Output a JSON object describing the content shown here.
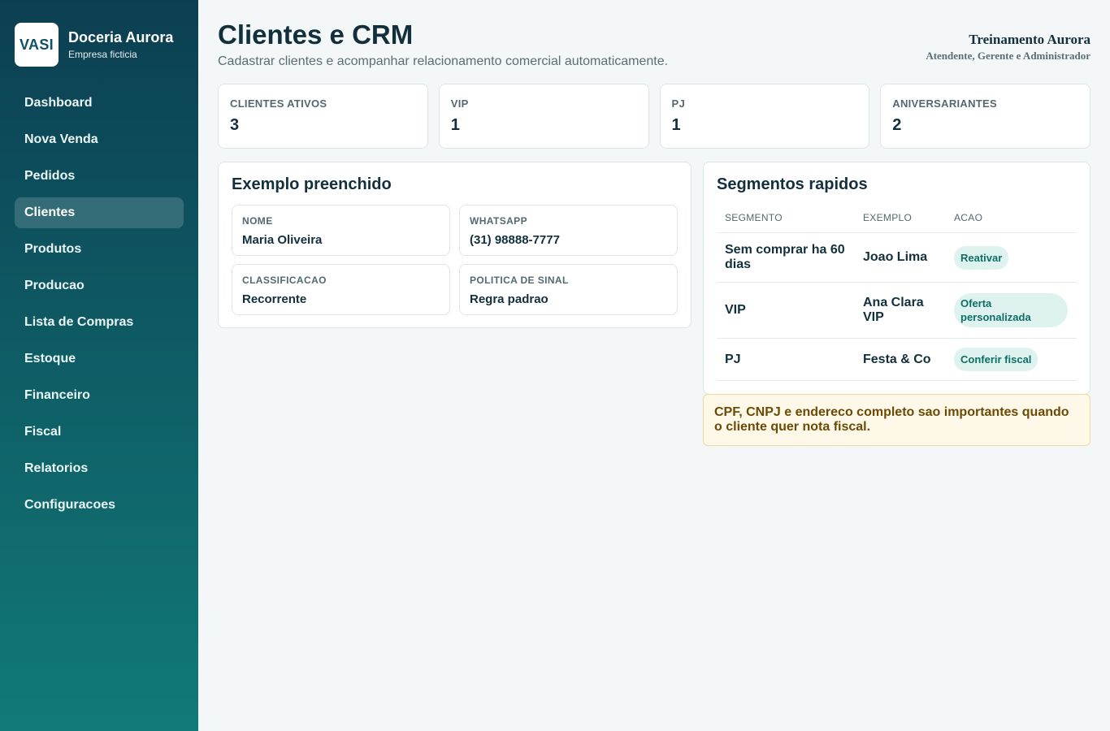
{
  "brand": {
    "logo": "VASI",
    "name": "Doceria Aurora",
    "subtitle": "Empresa ficticia"
  },
  "sidebar": {
    "items": [
      {
        "label": "Dashboard",
        "active": false
      },
      {
        "label": "Nova Venda",
        "active": false
      },
      {
        "label": "Pedidos",
        "active": false
      },
      {
        "label": "Clientes",
        "active": true
      },
      {
        "label": "Produtos",
        "active": false
      },
      {
        "label": "Producao",
        "active": false
      },
      {
        "label": "Lista de Compras",
        "active": false
      },
      {
        "label": "Estoque",
        "active": false
      },
      {
        "label": "Financeiro",
        "active": false
      },
      {
        "label": "Fiscal",
        "active": false
      },
      {
        "label": "Relatorios",
        "active": false
      },
      {
        "label": "Configuracoes",
        "active": false
      }
    ]
  },
  "header": {
    "title": "Clientes e CRM",
    "subtitle": "Cadastrar clientes e acompanhar relacionamento comercial automaticamente.",
    "user_name": "Treinamento Aurora",
    "user_role": "Atendente, Gerente e Administrador"
  },
  "stats": [
    {
      "label": "CLIENTES ATIVOS",
      "value": "3"
    },
    {
      "label": "VIP",
      "value": "1"
    },
    {
      "label": "PJ",
      "value": "1"
    },
    {
      "label": "ANIVERSARIANTES",
      "value": "2"
    }
  ],
  "example": {
    "title": "Exemplo preenchido",
    "fields": [
      {
        "label": "NOME",
        "value": "Maria Oliveira"
      },
      {
        "label": "WHATSAPP",
        "value": "(31) 98888-7777"
      },
      {
        "label": "CLASSIFICACAO",
        "value": "Recorrente"
      },
      {
        "label": "POLITICA DE SINAL",
        "value": "Regra padrao"
      }
    ]
  },
  "segments": {
    "title": "Segmentos rapidos",
    "columns": [
      "SEGMENTO",
      "EXEMPLO",
      "ACAO"
    ],
    "rows": [
      {
        "segment": "Sem comprar ha 60 dias",
        "example": "Joao Lima",
        "action": "Reativar"
      },
      {
        "segment": "VIP",
        "example": "Ana Clara VIP",
        "action": "Oferta personalizada"
      },
      {
        "segment": "PJ",
        "example": "Festa & Co",
        "action": "Conferir fiscal"
      }
    ]
  },
  "note": "CPF, CNPJ e endereco completo sao importantes quando o cliente quer nota fiscal.",
  "colors": {
    "sidebar_top": "#0c3f52",
    "sidebar_bottom": "#117a78",
    "pill_bg": "#def3f0",
    "note_bg": "#fef8e8"
  }
}
